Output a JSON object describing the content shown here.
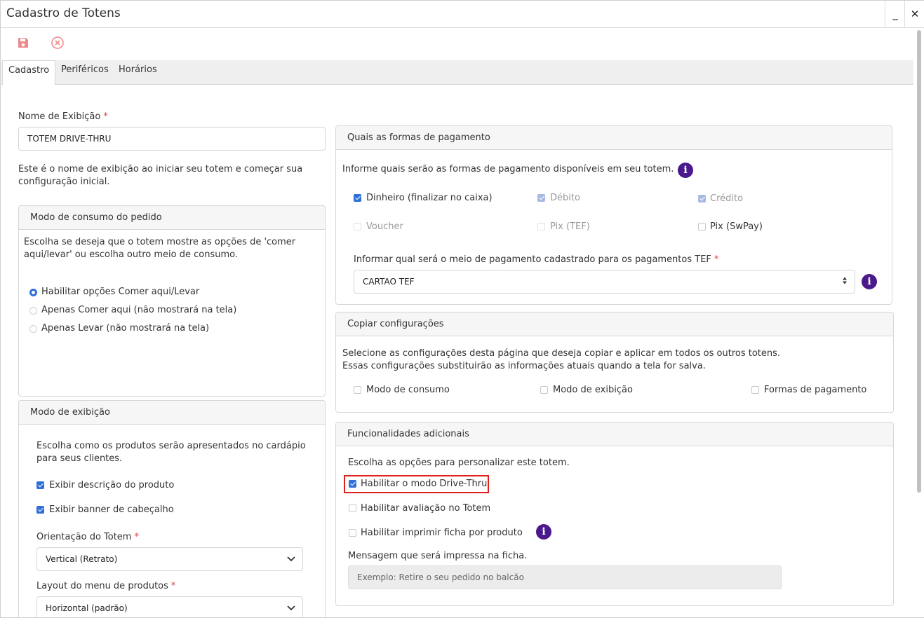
{
  "window": {
    "title": "Cadastro de Totens",
    "minimize": "_",
    "close": "✕"
  },
  "toolbar": {
    "save_icon": "save-icon",
    "cancel_icon": "cancel-circle-icon",
    "icon_color": "#f08a8a"
  },
  "tabs": [
    {
      "label": "Cadastro",
      "active": true
    },
    {
      "label": "Periféricos",
      "active": false
    },
    {
      "label": "Horários",
      "active": false
    }
  ],
  "nome": {
    "label": "Nome de Exibição",
    "required": "*",
    "value": "TOTEM DRIVE-THRU",
    "help": "Este é o nome de exibição ao iniciar seu totem e começar sua configuração inicial."
  },
  "consumo": {
    "title": "Modo de consumo do pedido",
    "description": "Escolha se deseja que o totem mostre as opções de 'comer aqui/levar' ou escolha outro meio de consumo.",
    "options": [
      {
        "label": "Habilitar opções Comer aqui/Levar",
        "selected": true
      },
      {
        "label": "Apenas Comer aqui (não mostrará na tela)",
        "selected": false
      },
      {
        "label": "Apenas Levar (não mostrará na tela)",
        "selected": false
      }
    ]
  },
  "exibicao": {
    "title": "Modo de exibição",
    "description": "Escolha como os produtos serão apresentados no cardápio para seus clientes.",
    "options": [
      {
        "label": "Exibir descrição do produto",
        "checked": true
      },
      {
        "label": "Exibir banner de cabeçalho",
        "checked": true
      }
    ],
    "orientacao_label": "Orientação do Totem",
    "orientacao_value": "Vertical (Retrato)",
    "layout_label": "Layout do menu de produtos",
    "layout_value": "Horizontal (padrão)",
    "required": "*"
  },
  "pagamento": {
    "title": "Quais as formas de pagamento",
    "description": "Informe quais serão as formas de pagamento disponíveis em seu totem.",
    "options": [
      {
        "label": "Dinheiro (finalizar no caixa)",
        "state": "checked"
      },
      {
        "label": "Débito",
        "state": "checked-disabled"
      },
      {
        "label": "Crédito",
        "state": "checked-disabled"
      },
      {
        "label": "Voucher",
        "state": "disabled"
      },
      {
        "label": "Pix (TEF)",
        "state": "disabled"
      },
      {
        "label": "Pix (SwPay)",
        "state": "unchecked"
      }
    ],
    "tef_label": "Informar qual será o meio de pagamento cadastrado para os pagamentos TEF",
    "tef_value": "CARTAO TEF",
    "required": "*"
  },
  "copiar": {
    "title": "Copiar configurações",
    "description": "Selecione as configurações desta página que deseja copiar e aplicar em todos os outros totens. Essas configurações substituirão as informações atuais quando a tela for salva.",
    "options": [
      {
        "label": "Modo de consumo",
        "checked": false
      },
      {
        "label": "Modo de exibição",
        "checked": false
      },
      {
        "label": "Formas de pagamento",
        "checked": false
      }
    ]
  },
  "funcionalidades": {
    "title": "Funcionalidades adicionais",
    "description": "Escolha as opções para personalizar este totem.",
    "options": [
      {
        "label": "Habilitar o modo Drive-Thru",
        "checked": true
      },
      {
        "label": "Habilitar avaliação no Totem",
        "checked": false
      },
      {
        "label": "Habilitar imprimir ficha por produto",
        "checked": false
      }
    ],
    "mensagem_label": "Mensagem que será impressa na ficha.",
    "mensagem_placeholder": "Exemplo: Retire o seu pedido no balcão"
  },
  "colors": {
    "accent": "#2f6fd8",
    "info": "#4a1a8c",
    "required": "#e0443e",
    "highlight": "#e0201a"
  }
}
